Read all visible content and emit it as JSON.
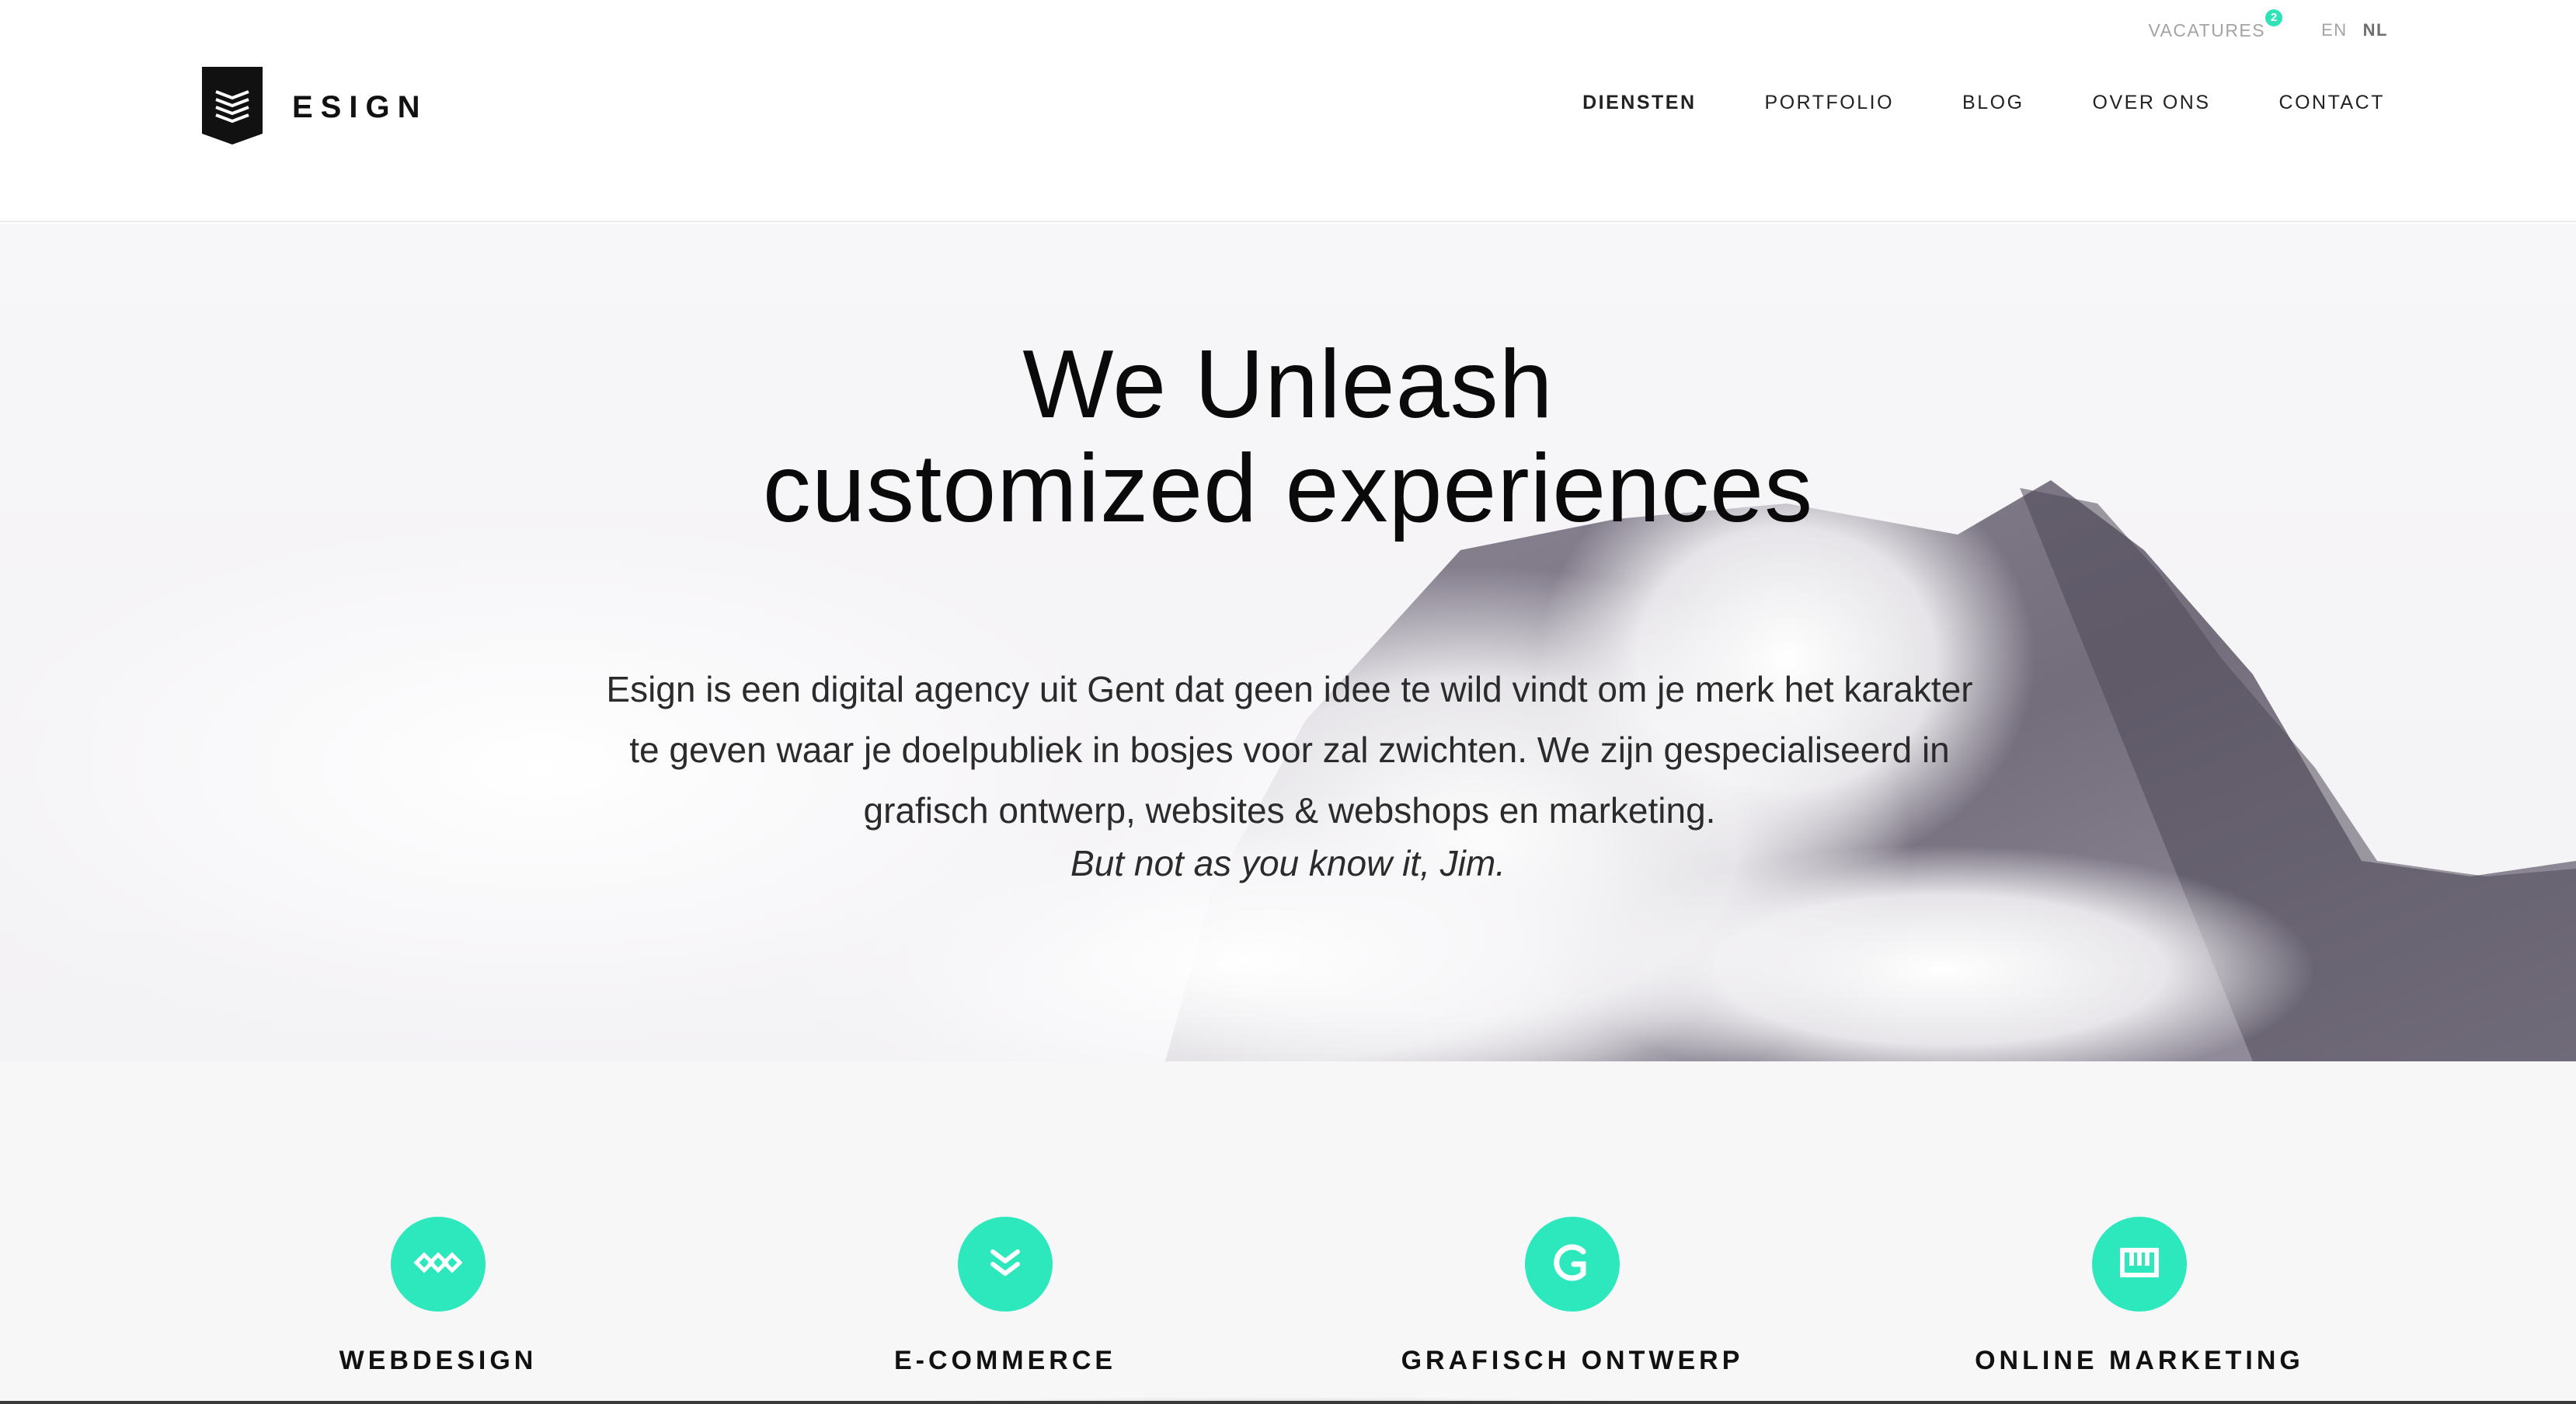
{
  "topbar": {
    "vacatures_label": "VACATURES",
    "vacatures_badge": "2",
    "languages": [
      {
        "code": "EN",
        "active": false
      },
      {
        "code": "NL",
        "active": true
      }
    ]
  },
  "brand": {
    "name": "ESIGN",
    "logo_icon": "shield-stack-icon"
  },
  "nav": {
    "items": [
      {
        "label": "DIENSTEN",
        "active": true
      },
      {
        "label": "PORTFOLIO",
        "active": false
      },
      {
        "label": "BLOG",
        "active": false
      },
      {
        "label": "OVER ONS",
        "active": false
      },
      {
        "label": "CONTACT",
        "active": false
      }
    ]
  },
  "hero": {
    "title_line1": "We Unleash",
    "title_line2": "customized experiences",
    "text_line1": "Esign is een digital agency uit Gent dat geen idee te wild vindt om je merk het karakter",
    "text_line2": "te geven waar je doelpubliek in bosjes voor zal zwichten. We zijn gespecialiseerd in",
    "text_line3": "grafisch ontwerp, websites & webshops en marketing.",
    "subline": "But not as you know it, Jim."
  },
  "services": [
    {
      "label": "WEBDESIGN",
      "icon": "chain-diamonds-icon"
    },
    {
      "label": "E-COMMERCE",
      "icon": "double-chevron-down-icon"
    },
    {
      "label": "GRAFISCH ONTWERP",
      "icon": "g-arc-icon"
    },
    {
      "label": "ONLINE MARKETING",
      "icon": "bar-chart-icon"
    }
  ],
  "colors": {
    "accent": "#2ee8bd",
    "badge": "#2ee3b8",
    "text": "#111111",
    "muted": "#a3a3a3"
  }
}
